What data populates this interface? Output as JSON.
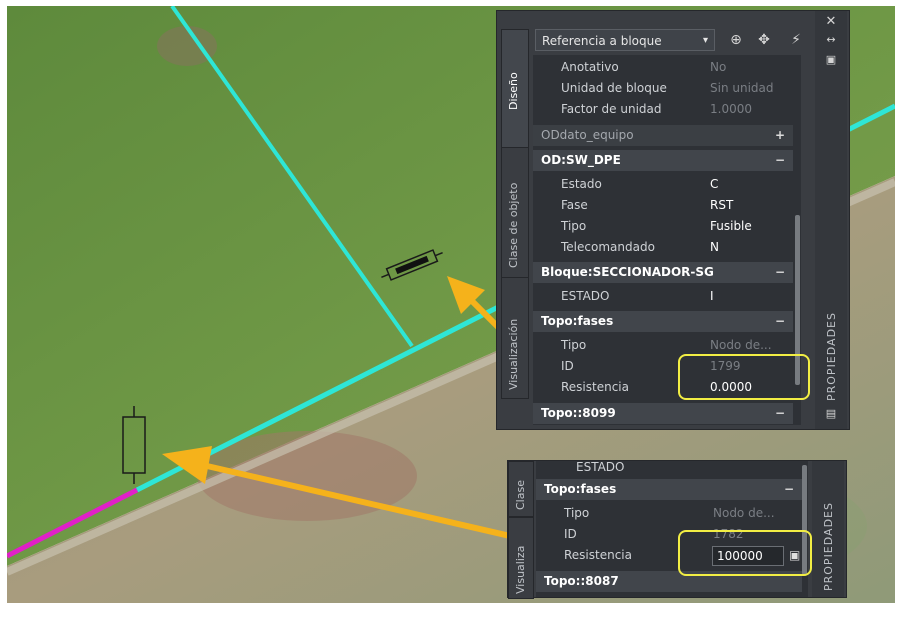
{
  "palette": {
    "object_selector": "Referencia a bloque",
    "tabs": [
      "Diseño",
      "Clase de objeto",
      "Visualización"
    ],
    "side_title": "PROPIEDADES",
    "rows": [
      {
        "label": "Anotativo",
        "value": "No",
        "dim": true
      },
      {
        "label": "Unidad de bloque",
        "value": "Sin unidad",
        "dim": true
      },
      {
        "label": "Factor de unidad",
        "value": "1.0000",
        "dim": true
      }
    ],
    "sections": {
      "od_dato_equipo": {
        "label": "ODdato_equipo",
        "toggle": "+"
      },
      "od_sw_dpe": {
        "label": "OD:SW_DPE",
        "toggle": "−"
      },
      "bloque": {
        "label": "Bloque:SECCIONADOR-SG",
        "toggle": "−"
      },
      "topo_fases": {
        "label": "Topo:fases",
        "toggle": "−"
      },
      "topo_8099": {
        "label": "Topo::8099",
        "toggle": "−"
      }
    },
    "sw_dpe_rows": [
      {
        "label": "Estado",
        "value": "C"
      },
      {
        "label": "Fase",
        "value": "RST"
      },
      {
        "label": "Tipo",
        "value": "Fusible"
      },
      {
        "label": "Telecomandado",
        "value": "N"
      }
    ],
    "bloque_rows": [
      {
        "label": "ESTADO",
        "value": "I"
      }
    ],
    "topo_rows": [
      {
        "label": "Tipo",
        "value": "Nodo de...",
        "dim": true
      },
      {
        "label": "ID",
        "value": "1799",
        "dim": true
      },
      {
        "label": "Resistencia",
        "value": "0.0000"
      }
    ]
  },
  "inset": {
    "estado_label": "ESTADO",
    "section_label": "Topo:fases",
    "section_toggle": "−",
    "rows": [
      {
        "label": "Tipo",
        "value": "Nodo de...",
        "dim": true
      },
      {
        "label": "ID",
        "value": "1782",
        "dim": true
      }
    ],
    "resistencia_label": "Resistencia",
    "resistencia_value": "100000",
    "footer_label": "Topo::8087",
    "tab_clase": "Clase",
    "tab_vis": "Visualiza",
    "side_title": "PROPIEDADES"
  },
  "colors": {
    "highlight": "#f2ee44",
    "arrow": "#f5b21b",
    "line_cyan": "#2ee6d6",
    "line_magenta": "#e020c8"
  }
}
